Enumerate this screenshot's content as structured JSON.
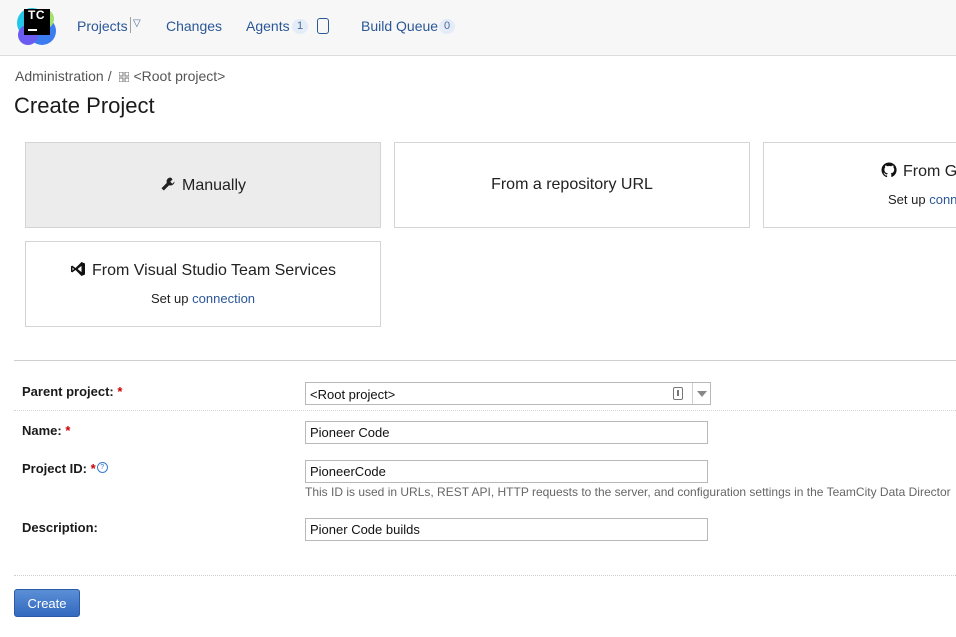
{
  "header": {
    "logo_text": "TC",
    "nav": {
      "projects": "Projects",
      "changes": "Changes",
      "agents": "Agents",
      "agents_count": "1",
      "build_queue": "Build Queue",
      "build_queue_count": "0"
    }
  },
  "breadcrumb": {
    "admin": "Administration",
    "separator": "/",
    "root": "<Root project>"
  },
  "page": {
    "title": "Create Project"
  },
  "options": {
    "manual": "Manually",
    "repo_url": "From a repository URL",
    "github_title": "From G",
    "github_setup": "Set up",
    "github_link": "conn",
    "vsts_title": "From Visual Studio Team Services",
    "vsts_setup": "Set up",
    "vsts_link": "connection"
  },
  "form": {
    "parent_label": "Parent project:",
    "parent_value": "<Root project>",
    "name_label": "Name:",
    "name_value": "Pioneer Code",
    "id_label": "Project ID:",
    "id_value": "PioneerCode",
    "id_note": "This ID is used in URLs, REST API, HTTP requests to the server, and configuration settings in the TeamCity Data Director",
    "desc_label": "Description:",
    "desc_value": "Pioner Code builds",
    "required_mark": "*",
    "help_mark": "?"
  },
  "actions": {
    "create": "Create"
  },
  "colors": {
    "link": "#2b5797",
    "required": "#cc0000",
    "primary_button": "#3369bf"
  }
}
